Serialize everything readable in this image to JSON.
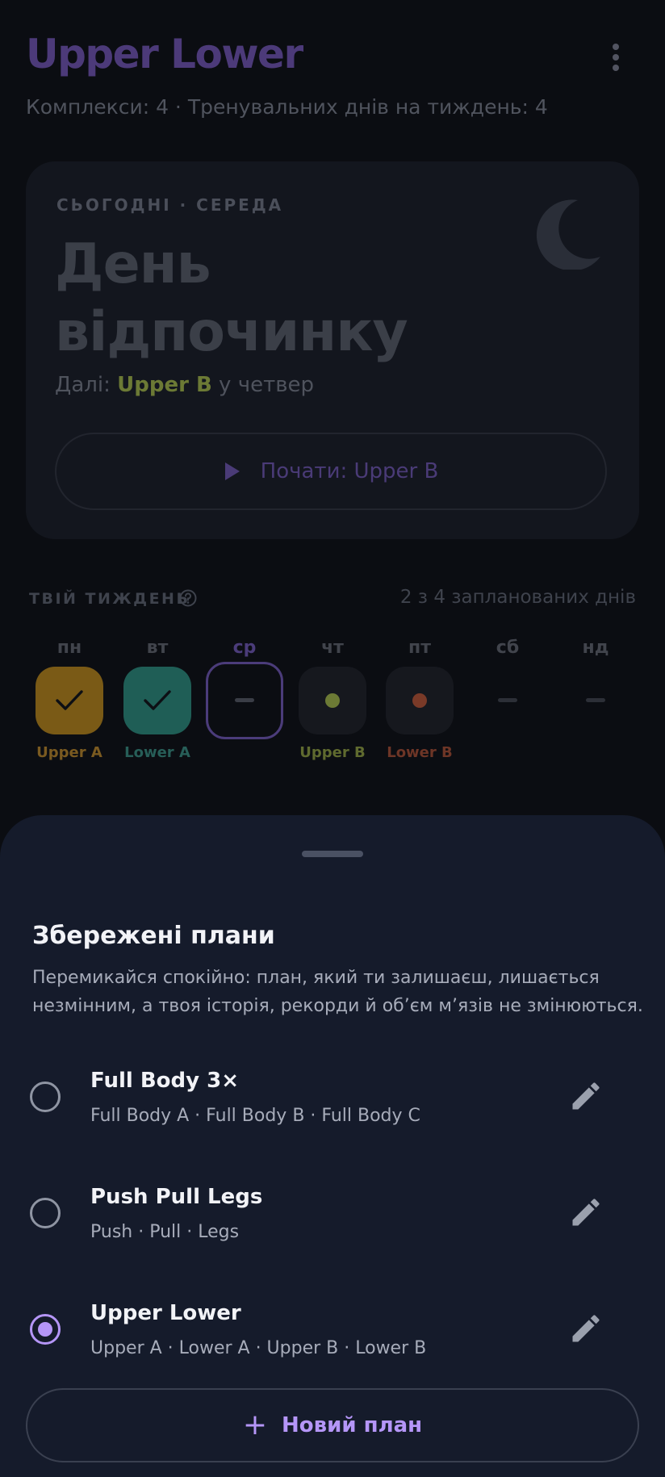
{
  "header": {
    "title": "Upper Lower",
    "subtitle": "Комплекси: 4 · Тренувальних днів на тиждень: 4"
  },
  "today": {
    "label": "СЬОГОДНІ · СЕРЕДА",
    "title": "День відпочинку",
    "next_prefix": "Далі: ",
    "next_plan": "Upper B",
    "next_suffix": " у четвер",
    "start_button": "Почати: Upper B"
  },
  "week": {
    "label": "ТВІЙ ТИЖДЕНЬ",
    "count": "2 з 4 запланованих днів",
    "days": [
      {
        "name": "пн",
        "plan": "Upper A",
        "state": "done",
        "color": "#7a5a16",
        "text_color": "#7a5a20"
      },
      {
        "name": "вт",
        "plan": "Lower A",
        "state": "done",
        "color": "#1f5e56",
        "text_color": "#275e58"
      },
      {
        "name": "ср",
        "plan": "",
        "state": "today",
        "color": "#4b3c7a",
        "text_color": ""
      },
      {
        "name": "чт",
        "plan": "Upper B",
        "state": "planned",
        "color": "#6c7a35",
        "text_color": "#5f6a2f"
      },
      {
        "name": "пт",
        "plan": "Lower B",
        "state": "planned",
        "color": "#7a3a28",
        "text_color": "#6d3526"
      },
      {
        "name": "сб",
        "plan": "",
        "state": "rest",
        "color": "",
        "text_color": ""
      },
      {
        "name": "нд",
        "plan": "",
        "state": "rest",
        "color": "",
        "text_color": ""
      }
    ]
  },
  "sheet": {
    "title": "Збережені плани",
    "description": "Перемикайся спокійно: план, який ти залишаєш, лишається незмінним, а твоя історія, рекорди й об’єм м’язів не змінюються.",
    "plans": [
      {
        "name": "Full Body 3×",
        "workouts": "Full Body A · Full Body B · Full Body C",
        "selected": false
      },
      {
        "name": "Push Pull Legs",
        "workouts": "Push · Pull · Legs",
        "selected": false
      },
      {
        "name": "Upper Lower",
        "workouts": "Upper A · Lower A · Upper B · Lower B",
        "selected": true
      }
    ],
    "new_plan_button": "Новий план"
  },
  "colors": {
    "accent": "#b596f8",
    "sheet_bg": "#151b2b",
    "background": "#0b0d12"
  }
}
